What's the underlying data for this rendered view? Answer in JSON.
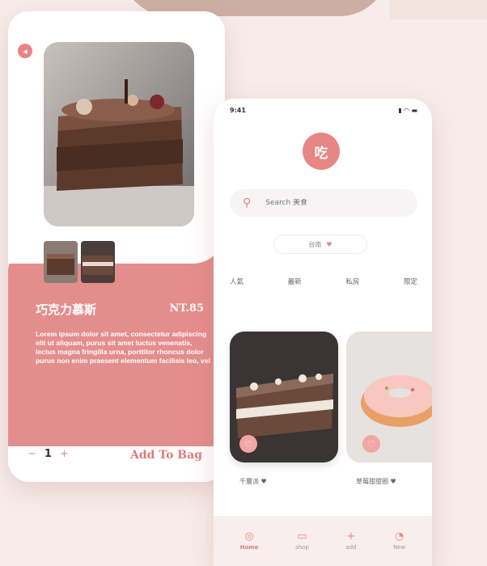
{
  "detail": {
    "back_icon": "back-arrow-icon",
    "product_name": "巧克力慕斯",
    "price": "NT.85",
    "description": "Lorem ipsum dolor sit amet, consectetur adipiscing elit ut aliquam, purus sit amet luctus venenatis, lectus magna fringilla urna, porttitor rhoncus dolor purus non enim praesent elementum facilisis leo, vel",
    "quantity": "1",
    "minus": "−",
    "plus": "+",
    "add_to_bag": "Add To Bag"
  },
  "home": {
    "status_time": "9:41",
    "status_icons": "▮ ◠ ▬",
    "logo_text": "吃",
    "search_placeholder": "Search 美食",
    "region": "台南",
    "categories": [
      "人氣",
      "最新",
      "私房",
      "限定"
    ],
    "cards": [
      {
        "label": "千層派 ♥"
      },
      {
        "label": "草莓甜甜圈 ♥"
      }
    ],
    "tabs": [
      {
        "label": "Home",
        "icon": "home-icon"
      },
      {
        "label": "shop",
        "icon": "shop-icon"
      },
      {
        "label": "add",
        "icon": "plus-icon"
      },
      {
        "label": "New",
        "icon": "new-icon"
      }
    ]
  },
  "colors": {
    "accent": "#e88585",
    "pink_panel": "#e48d8d",
    "background": "#f7ecea"
  }
}
